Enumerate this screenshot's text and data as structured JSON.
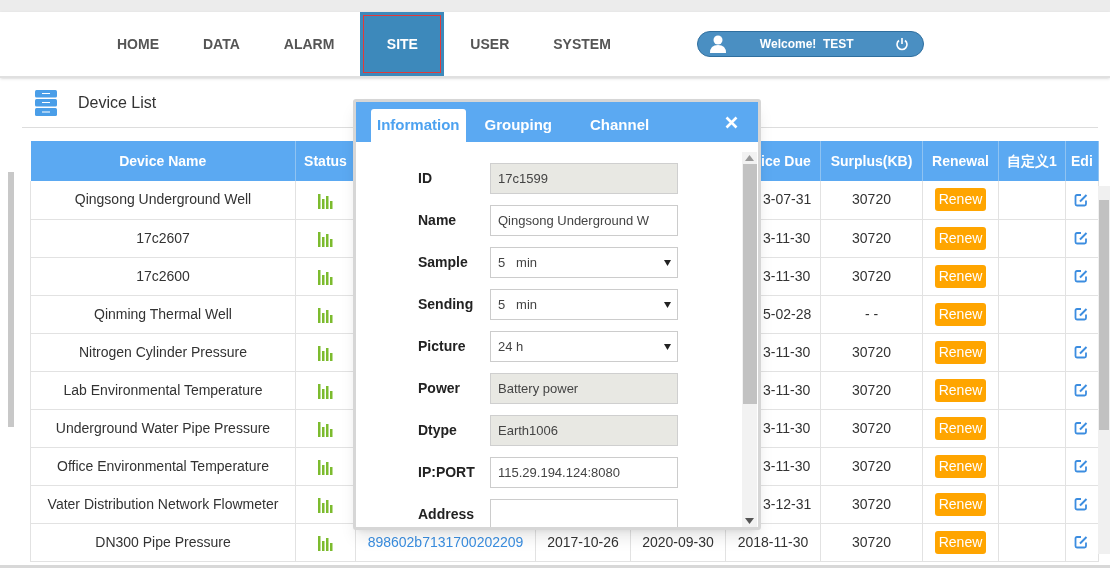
{
  "nav": {
    "items": [
      {
        "label": "HOME",
        "selected": false
      },
      {
        "label": "DATA",
        "selected": false
      },
      {
        "label": "ALARM",
        "selected": false
      },
      {
        "label": "SITE",
        "selected": true
      },
      {
        "label": "USER",
        "selected": false
      },
      {
        "label": "SYSTEM",
        "selected": false
      }
    ]
  },
  "user": {
    "greeting": "Welcome!",
    "username": "TEST"
  },
  "page_title": "Device List",
  "table": {
    "header": {
      "device_name": "Device Name",
      "status": "Status",
      "service_due": "ice Due",
      "surplus": "Surplus(KB)",
      "renewal": "Renewal",
      "custom_1": "自定义1",
      "edit": "Edi"
    },
    "rows": [
      {
        "device_name": "Qingsong Underground Well",
        "service_due": "3-07-31",
        "surplus": "30720",
        "renewal": "Renew"
      },
      {
        "device_name": "17c2607",
        "service_due": "3-11-30",
        "surplus": "30720",
        "renewal": "Renew"
      },
      {
        "device_name": "17c2600",
        "service_due": "3-11-30",
        "surplus": "30720",
        "renewal": "Renew"
      },
      {
        "device_name": "Qinming Thermal Well",
        "service_due": "5-02-28",
        "surplus": "- -",
        "renewal": "Renew"
      },
      {
        "device_name": "Nitrogen Cylinder Pressure",
        "service_due": "3-11-30",
        "surplus": "30720",
        "renewal": "Renew"
      },
      {
        "device_name": "Lab Environmental Temperature",
        "service_due": "3-11-30",
        "surplus": "30720",
        "renewal": "Renew"
      },
      {
        "device_name": "Underground Water Pipe Pressure",
        "service_due": "3-11-30",
        "surplus": "30720",
        "renewal": "Renew"
      },
      {
        "device_name": "Office Environmental Temperature",
        "service_due": "3-11-30",
        "surplus": "30720",
        "renewal": "Renew"
      },
      {
        "device_name": "Vater Distribution Network Flowmeter",
        "service_due": "3-12-31",
        "surplus": "30720",
        "renewal": "Renew"
      },
      {
        "device_name": "DN300 Pipe Pressure",
        "column_3": "898602b7131700202209",
        "column_4": "2017-10-26",
        "column_5": "2020-09-30",
        "service_due": "2018-11-30",
        "surplus": "30720",
        "renewal": "Renew"
      }
    ]
  },
  "dialog": {
    "tabs": [
      {
        "label": "Information",
        "selected": true
      },
      {
        "label": "Grouping",
        "selected": false
      },
      {
        "label": "Channel",
        "selected": false
      }
    ],
    "fields": [
      {
        "label": "ID",
        "kind": "readonly",
        "value": "17c1599"
      },
      {
        "label": "Name",
        "kind": "text",
        "value": "Qingsong Underground W"
      },
      {
        "label": "Sample",
        "kind": "select",
        "value": "5   min"
      },
      {
        "label": "Sending",
        "kind": "select",
        "value": "5   min"
      },
      {
        "label": "Picture",
        "kind": "select",
        "value": "24 h"
      },
      {
        "label": "Power",
        "kind": "readonly",
        "value": "Battery power"
      },
      {
        "label": "Dtype",
        "kind": "readonly",
        "value": "Earth1006"
      },
      {
        "label": "IP:PORT",
        "kind": "text",
        "value": "115.29.194.124:8080"
      },
      {
        "label": "Address",
        "kind": "text"
      }
    ]
  }
}
